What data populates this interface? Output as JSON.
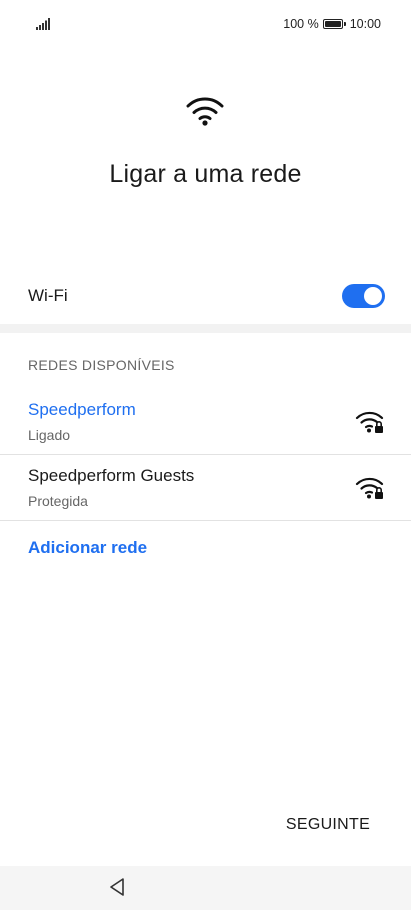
{
  "status_bar": {
    "battery_text": "100 %",
    "time": "10:00",
    "icons": [
      "signal-icon",
      "battery-icon"
    ]
  },
  "header": {
    "icon": "wifi-icon",
    "title": "Ligar a uma rede"
  },
  "wifi": {
    "label": "Wi-Fi",
    "enabled": true
  },
  "networks_section": {
    "title": "REDES DISPONÍVEIS",
    "networks": [
      {
        "name": "Speedperform",
        "status": "Ligado",
        "connected": true,
        "icon": "wifi-lock-icon"
      },
      {
        "name": "Speedperform Guests",
        "status": "Protegida",
        "connected": false,
        "icon": "wifi-lock-icon"
      }
    ],
    "add_network_label": "Adicionar rede"
  },
  "footer": {
    "next_label": "SEGUINTE"
  },
  "nav_bar": {
    "icons": [
      "back-icon"
    ]
  },
  "colors": {
    "accent": "#1f6ff0",
    "text": "#1a1a1a",
    "secondary_text": "#666666"
  }
}
